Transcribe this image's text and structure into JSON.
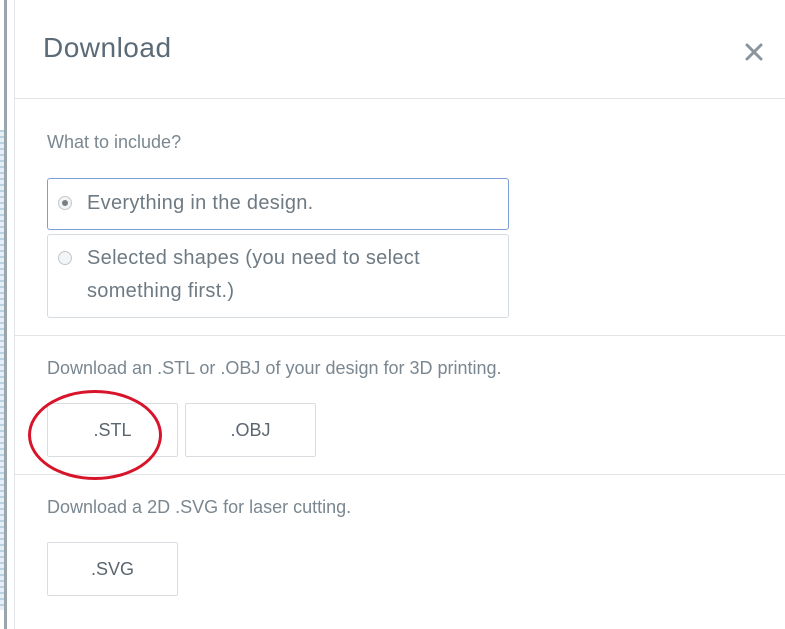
{
  "dialog": {
    "title": "Download",
    "close_icon": "close-icon"
  },
  "include": {
    "question": "What to include?",
    "options": [
      {
        "label": "Everything in the design.",
        "checked": true
      },
      {
        "label_line1": "Selected shapes (you need to select",
        "label_line2": "something first.)",
        "checked": false
      }
    ]
  },
  "print3d": {
    "description": "Download an .STL or .OBJ of your design for 3D printing.",
    "stl_label": ".STL",
    "obj_label": ".OBJ"
  },
  "laser": {
    "description": "Download a 2D .SVG for laser cutting.",
    "svg_label": ".SVG"
  },
  "colors": {
    "title": "#5a6a76",
    "annotation": "#d7142a",
    "selected_border": "#7d9fd6"
  }
}
